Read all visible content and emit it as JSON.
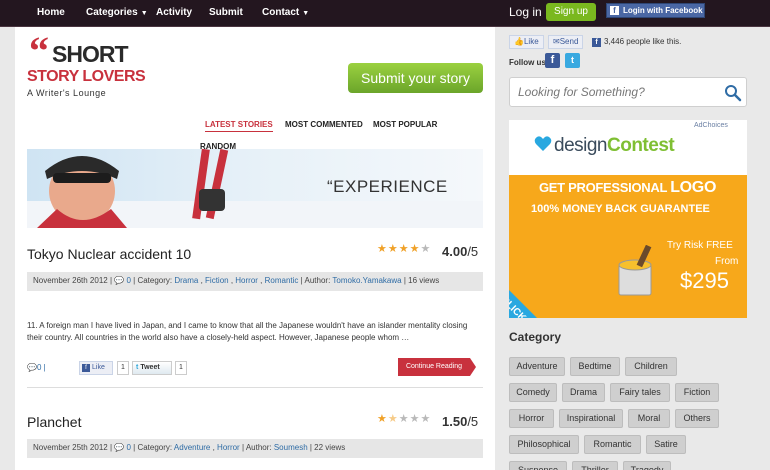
{
  "nav": {
    "items": [
      {
        "label": "Home",
        "caret": false
      },
      {
        "label": "Categories",
        "caret": true
      },
      {
        "label": "Activity",
        "caret": false
      },
      {
        "label": "Submit",
        "caret": false
      },
      {
        "label": "Contact",
        "caret": true
      }
    ],
    "login": "Log in",
    "signup": "Sign up",
    "facebook_login": "Login with Facebook"
  },
  "logo": {
    "quote": "“",
    "line1": "SHORT",
    "line2": "STORY LOVERS",
    "tagline": "A Writer's Lounge"
  },
  "submit_button": "Submit your story",
  "tabs": [
    {
      "label": "LATEST STORIES",
      "active": true
    },
    {
      "label": "MOST COMMENTED",
      "active": false
    },
    {
      "label": "MOST POPULAR",
      "active": false
    },
    {
      "label": "RANDOM",
      "active": false
    }
  ],
  "banner": {
    "text": "“EXPERIENCE"
  },
  "posts": [
    {
      "title": "Tokyo Nuclear accident 10",
      "rating": "4.00",
      "rating_max": "/5",
      "stars": 4,
      "date": "November 26th 2012",
      "comments": "0",
      "category_label": "Category:",
      "categories": [
        "Drama",
        "Fiction",
        "Horror",
        "Romantic"
      ],
      "author_label": "Author:",
      "author": "Tomoko.Yamakawa",
      "views": "16 views",
      "excerpt": "11. A foreign man I have lived in Japan, and I came to know that all the Japanese wouldn't have an islander mentality closing their country. All countries in the world also have a closely-held aspect. However, Japanese people whom …",
      "footer_comments": "0",
      "like_label": "Like",
      "like_count": "1",
      "tweet_label": "Tweet",
      "tweet_count": "1",
      "continue": "Continue Reading"
    },
    {
      "title": "Planchet",
      "rating": "1.50",
      "rating_max": "/5",
      "stars": 1.5,
      "date": "November 25th 2012",
      "comments": "0",
      "category_label": "Category:",
      "categories": [
        "Adventure",
        "Horror"
      ],
      "author_label": "Author:",
      "author": "Soumesh",
      "views": "22 views"
    }
  ],
  "sidebar": {
    "like": "Like",
    "send": "Send",
    "people_like": "3,446 people like this.",
    "follow_us": "Follow us",
    "search_placeholder": "Looking for Something?",
    "ad": {
      "choices": "AdChoices",
      "brand_a": "design",
      "brand_b": "Contest",
      "headline_a": "GET PROFESSIONAL",
      "headline_b": "LOGO",
      "sub": "100% MONEY BACK GUARANTEE",
      "try": "Try Risk FREE",
      "from": "From",
      "price": "$295",
      "click": "CLICK HERE"
    },
    "category_title": "Category",
    "categories": [
      "Adventure",
      "Bedtime",
      "Children",
      "Comedy",
      "Drama",
      "Fairy tales",
      "Fiction",
      "Horror",
      "Inspirational",
      "Moral",
      "Others",
      "Philosophical",
      "Romantic",
      "Satire",
      "Suspense",
      "Thriller",
      "Tragedy"
    ]
  }
}
